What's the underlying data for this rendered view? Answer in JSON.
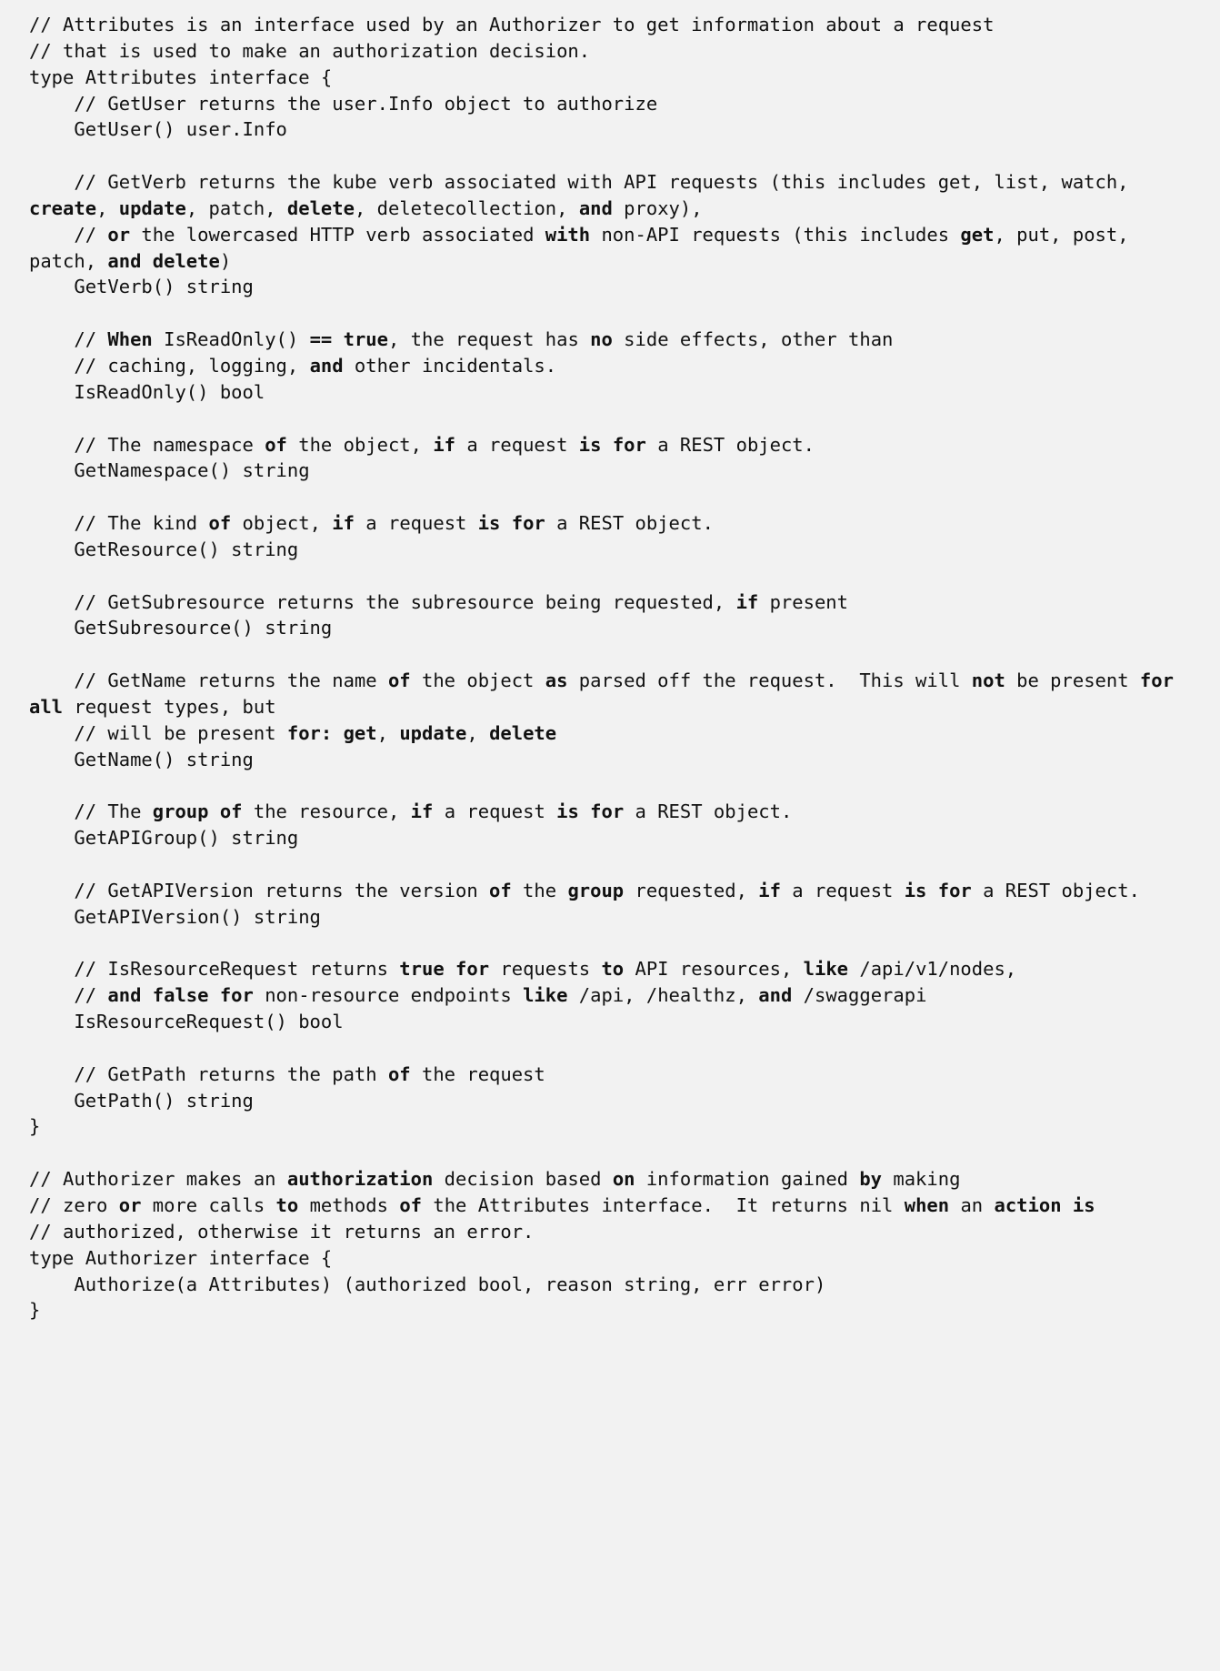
{
  "document": {
    "kind": "source-code-text",
    "language": "go",
    "background_color": "#f2f2f2",
    "text_color": "#111111",
    "lines": [
      {
        "indent": 0,
        "tokens": [
          {
            "t": "// Attributes is an interface used by an Authorizer to get information about a request",
            "b": false
          }
        ]
      },
      {
        "indent": 0,
        "tokens": [
          {
            "t": "// that is used to make an authorization decision.",
            "b": false
          }
        ]
      },
      {
        "indent": 0,
        "tokens": [
          {
            "t": "type Attributes interface {",
            "b": false
          }
        ]
      },
      {
        "indent": 1,
        "tokens": [
          {
            "t": "// GetUser returns the user.Info object to authorize",
            "b": false
          }
        ]
      },
      {
        "indent": 1,
        "tokens": [
          {
            "t": "GetUser() user.Info",
            "b": false
          }
        ]
      },
      {
        "indent": 0,
        "blank": true,
        "tokens": []
      },
      {
        "indent": 1,
        "tokens": [
          {
            "t": "// GetVerb returns the kube verb associated with API requests (this includes get, list, watch, ",
            "b": false
          },
          {
            "t": "create",
            "b": true
          },
          {
            "t": ", ",
            "b": false
          },
          {
            "t": "update",
            "b": true
          },
          {
            "t": ", patch, ",
            "b": false
          },
          {
            "t": "delete",
            "b": true
          },
          {
            "t": ", deletecollection, ",
            "b": false
          },
          {
            "t": "and",
            "b": true
          },
          {
            "t": " proxy),",
            "b": false
          }
        ]
      },
      {
        "indent": 1,
        "tokens": [
          {
            "t": "// ",
            "b": false
          },
          {
            "t": "or",
            "b": true
          },
          {
            "t": " the lowercased HTTP verb associated ",
            "b": false
          },
          {
            "t": "with",
            "b": true
          },
          {
            "t": " non-API requests (this includes ",
            "b": false
          },
          {
            "t": "get",
            "b": true
          },
          {
            "t": ", put, post, patch, ",
            "b": false
          },
          {
            "t": "and delete",
            "b": true
          },
          {
            "t": ")",
            "b": false
          }
        ]
      },
      {
        "indent": 1,
        "tokens": [
          {
            "t": "GetVerb() string",
            "b": false
          }
        ]
      },
      {
        "indent": 0,
        "blank": true,
        "tokens": []
      },
      {
        "indent": 1,
        "tokens": [
          {
            "t": "// ",
            "b": false
          },
          {
            "t": "When",
            "b": true
          },
          {
            "t": " IsReadOnly() ",
            "b": false
          },
          {
            "t": "==",
            "b": true
          },
          {
            "t": " ",
            "b": false
          },
          {
            "t": "true",
            "b": true
          },
          {
            "t": ", the request has ",
            "b": false
          },
          {
            "t": "no",
            "b": true
          },
          {
            "t": " side effects, other than",
            "b": false
          }
        ]
      },
      {
        "indent": 1,
        "tokens": [
          {
            "t": "// caching, logging, ",
            "b": false
          },
          {
            "t": "and",
            "b": true
          },
          {
            "t": " other incidentals.",
            "b": false
          }
        ]
      },
      {
        "indent": 1,
        "tokens": [
          {
            "t": "IsReadOnly() bool",
            "b": false
          }
        ]
      },
      {
        "indent": 0,
        "blank": true,
        "tokens": []
      },
      {
        "indent": 1,
        "tokens": [
          {
            "t": "// The namespace ",
            "b": false
          },
          {
            "t": "of",
            "b": true
          },
          {
            "t": " the object, ",
            "b": false
          },
          {
            "t": "if",
            "b": true
          },
          {
            "t": " a request ",
            "b": false
          },
          {
            "t": "is for",
            "b": true
          },
          {
            "t": " a REST object.",
            "b": false
          }
        ]
      },
      {
        "indent": 1,
        "tokens": [
          {
            "t": "GetNamespace() string",
            "b": false
          }
        ]
      },
      {
        "indent": 0,
        "blank": true,
        "tokens": []
      },
      {
        "indent": 1,
        "tokens": [
          {
            "t": "// The kind ",
            "b": false
          },
          {
            "t": "of",
            "b": true
          },
          {
            "t": " object, ",
            "b": false
          },
          {
            "t": "if",
            "b": true
          },
          {
            "t": " a request ",
            "b": false
          },
          {
            "t": "is for",
            "b": true
          },
          {
            "t": " a REST object.",
            "b": false
          }
        ]
      },
      {
        "indent": 1,
        "tokens": [
          {
            "t": "GetResource() string",
            "b": false
          }
        ]
      },
      {
        "indent": 0,
        "blank": true,
        "tokens": []
      },
      {
        "indent": 1,
        "tokens": [
          {
            "t": "// GetSubresource returns the subresource being requested, ",
            "b": false
          },
          {
            "t": "if",
            "b": true
          },
          {
            "t": " present",
            "b": false
          }
        ]
      },
      {
        "indent": 1,
        "tokens": [
          {
            "t": "GetSubresource() string",
            "b": false
          }
        ]
      },
      {
        "indent": 0,
        "blank": true,
        "tokens": []
      },
      {
        "indent": 1,
        "tokens": [
          {
            "t": "// GetName returns the name ",
            "b": false
          },
          {
            "t": "of",
            "b": true
          },
          {
            "t": " the object ",
            "b": false
          },
          {
            "t": "as",
            "b": true
          },
          {
            "t": " parsed off the request.  This will ",
            "b": false
          },
          {
            "t": "not",
            "b": true
          },
          {
            "t": " be present ",
            "b": false
          },
          {
            "t": "for all",
            "b": true
          },
          {
            "t": " request types, but",
            "b": false
          }
        ]
      },
      {
        "indent": 1,
        "tokens": [
          {
            "t": "// will be present ",
            "b": false
          },
          {
            "t": "for:",
            "b": true
          },
          {
            "t": " ",
            "b": false
          },
          {
            "t": "get",
            "b": true
          },
          {
            "t": ", ",
            "b": false
          },
          {
            "t": "update",
            "b": true
          },
          {
            "t": ", ",
            "b": false
          },
          {
            "t": "delete",
            "b": true
          }
        ]
      },
      {
        "indent": 1,
        "tokens": [
          {
            "t": "GetName() string",
            "b": false
          }
        ]
      },
      {
        "indent": 0,
        "blank": true,
        "tokens": []
      },
      {
        "indent": 1,
        "tokens": [
          {
            "t": "// The ",
            "b": false
          },
          {
            "t": "group of",
            "b": true
          },
          {
            "t": " the resource, ",
            "b": false
          },
          {
            "t": "if",
            "b": true
          },
          {
            "t": " a request ",
            "b": false
          },
          {
            "t": "is for",
            "b": true
          },
          {
            "t": " a REST object.",
            "b": false
          }
        ]
      },
      {
        "indent": 1,
        "tokens": [
          {
            "t": "GetAPIGroup() string",
            "b": false
          }
        ]
      },
      {
        "indent": 0,
        "blank": true,
        "tokens": []
      },
      {
        "indent": 1,
        "tokens": [
          {
            "t": "// GetAPIVersion returns the version ",
            "b": false
          },
          {
            "t": "of",
            "b": true
          },
          {
            "t": " the ",
            "b": false
          },
          {
            "t": "group",
            "b": true
          },
          {
            "t": " requested, ",
            "b": false
          },
          {
            "t": "if",
            "b": true
          },
          {
            "t": " a request ",
            "b": false
          },
          {
            "t": "is for",
            "b": true
          },
          {
            "t": " a REST object.",
            "b": false
          }
        ]
      },
      {
        "indent": 1,
        "tokens": [
          {
            "t": "GetAPIVersion() string",
            "b": false
          }
        ]
      },
      {
        "indent": 0,
        "blank": true,
        "tokens": []
      },
      {
        "indent": 1,
        "tokens": [
          {
            "t": "// IsResourceRequest returns ",
            "b": false
          },
          {
            "t": "true for",
            "b": true
          },
          {
            "t": " requests ",
            "b": false
          },
          {
            "t": "to",
            "b": true
          },
          {
            "t": " API resources, ",
            "b": false
          },
          {
            "t": "like",
            "b": true
          },
          {
            "t": " /api/v1/nodes,",
            "b": false
          }
        ]
      },
      {
        "indent": 1,
        "tokens": [
          {
            "t": "// ",
            "b": false
          },
          {
            "t": "and false for",
            "b": true
          },
          {
            "t": " non-resource endpoints ",
            "b": false
          },
          {
            "t": "like",
            "b": true
          },
          {
            "t": " /api, /healthz, ",
            "b": false
          },
          {
            "t": "and",
            "b": true
          },
          {
            "t": " /swaggerapi",
            "b": false
          }
        ]
      },
      {
        "indent": 1,
        "tokens": [
          {
            "t": "IsResourceRequest() bool",
            "b": false
          }
        ]
      },
      {
        "indent": 0,
        "blank": true,
        "tokens": []
      },
      {
        "indent": 1,
        "tokens": [
          {
            "t": "// GetPath returns the path ",
            "b": false
          },
          {
            "t": "of",
            "b": true
          },
          {
            "t": " the request",
            "b": false
          }
        ]
      },
      {
        "indent": 1,
        "tokens": [
          {
            "t": "GetPath() string",
            "b": false
          }
        ]
      },
      {
        "indent": 0,
        "tokens": [
          {
            "t": "}",
            "b": false
          }
        ]
      },
      {
        "indent": 0,
        "blank": true,
        "tokens": []
      },
      {
        "indent": 0,
        "tokens": [
          {
            "t": "// Authorizer makes an ",
            "b": false
          },
          {
            "t": "authorization",
            "b": true
          },
          {
            "t": " decision based ",
            "b": false
          },
          {
            "t": "on",
            "b": true
          },
          {
            "t": " information gained ",
            "b": false
          },
          {
            "t": "by",
            "b": true
          },
          {
            "t": " making",
            "b": false
          }
        ]
      },
      {
        "indent": 0,
        "tokens": [
          {
            "t": "// zero ",
            "b": false
          },
          {
            "t": "or",
            "b": true
          },
          {
            "t": " more calls ",
            "b": false
          },
          {
            "t": "to",
            "b": true
          },
          {
            "t": " methods ",
            "b": false
          },
          {
            "t": "of",
            "b": true
          },
          {
            "t": " the Attributes interface.  It returns nil ",
            "b": false
          },
          {
            "t": "when",
            "b": true
          },
          {
            "t": " an ",
            "b": false
          },
          {
            "t": "action is",
            "b": true
          }
        ]
      },
      {
        "indent": 0,
        "tokens": [
          {
            "t": "// authorized, otherwise it returns an error.",
            "b": false
          }
        ]
      },
      {
        "indent": 0,
        "tokens": [
          {
            "t": "type Authorizer interface {",
            "b": false
          }
        ]
      },
      {
        "indent": 1,
        "tokens": [
          {
            "t": "Authorize(a Attributes) (authorized bool, reason string, err error)",
            "b": false
          }
        ]
      },
      {
        "indent": 0,
        "tokens": [
          {
            "t": "}",
            "b": false
          }
        ]
      }
    ]
  }
}
